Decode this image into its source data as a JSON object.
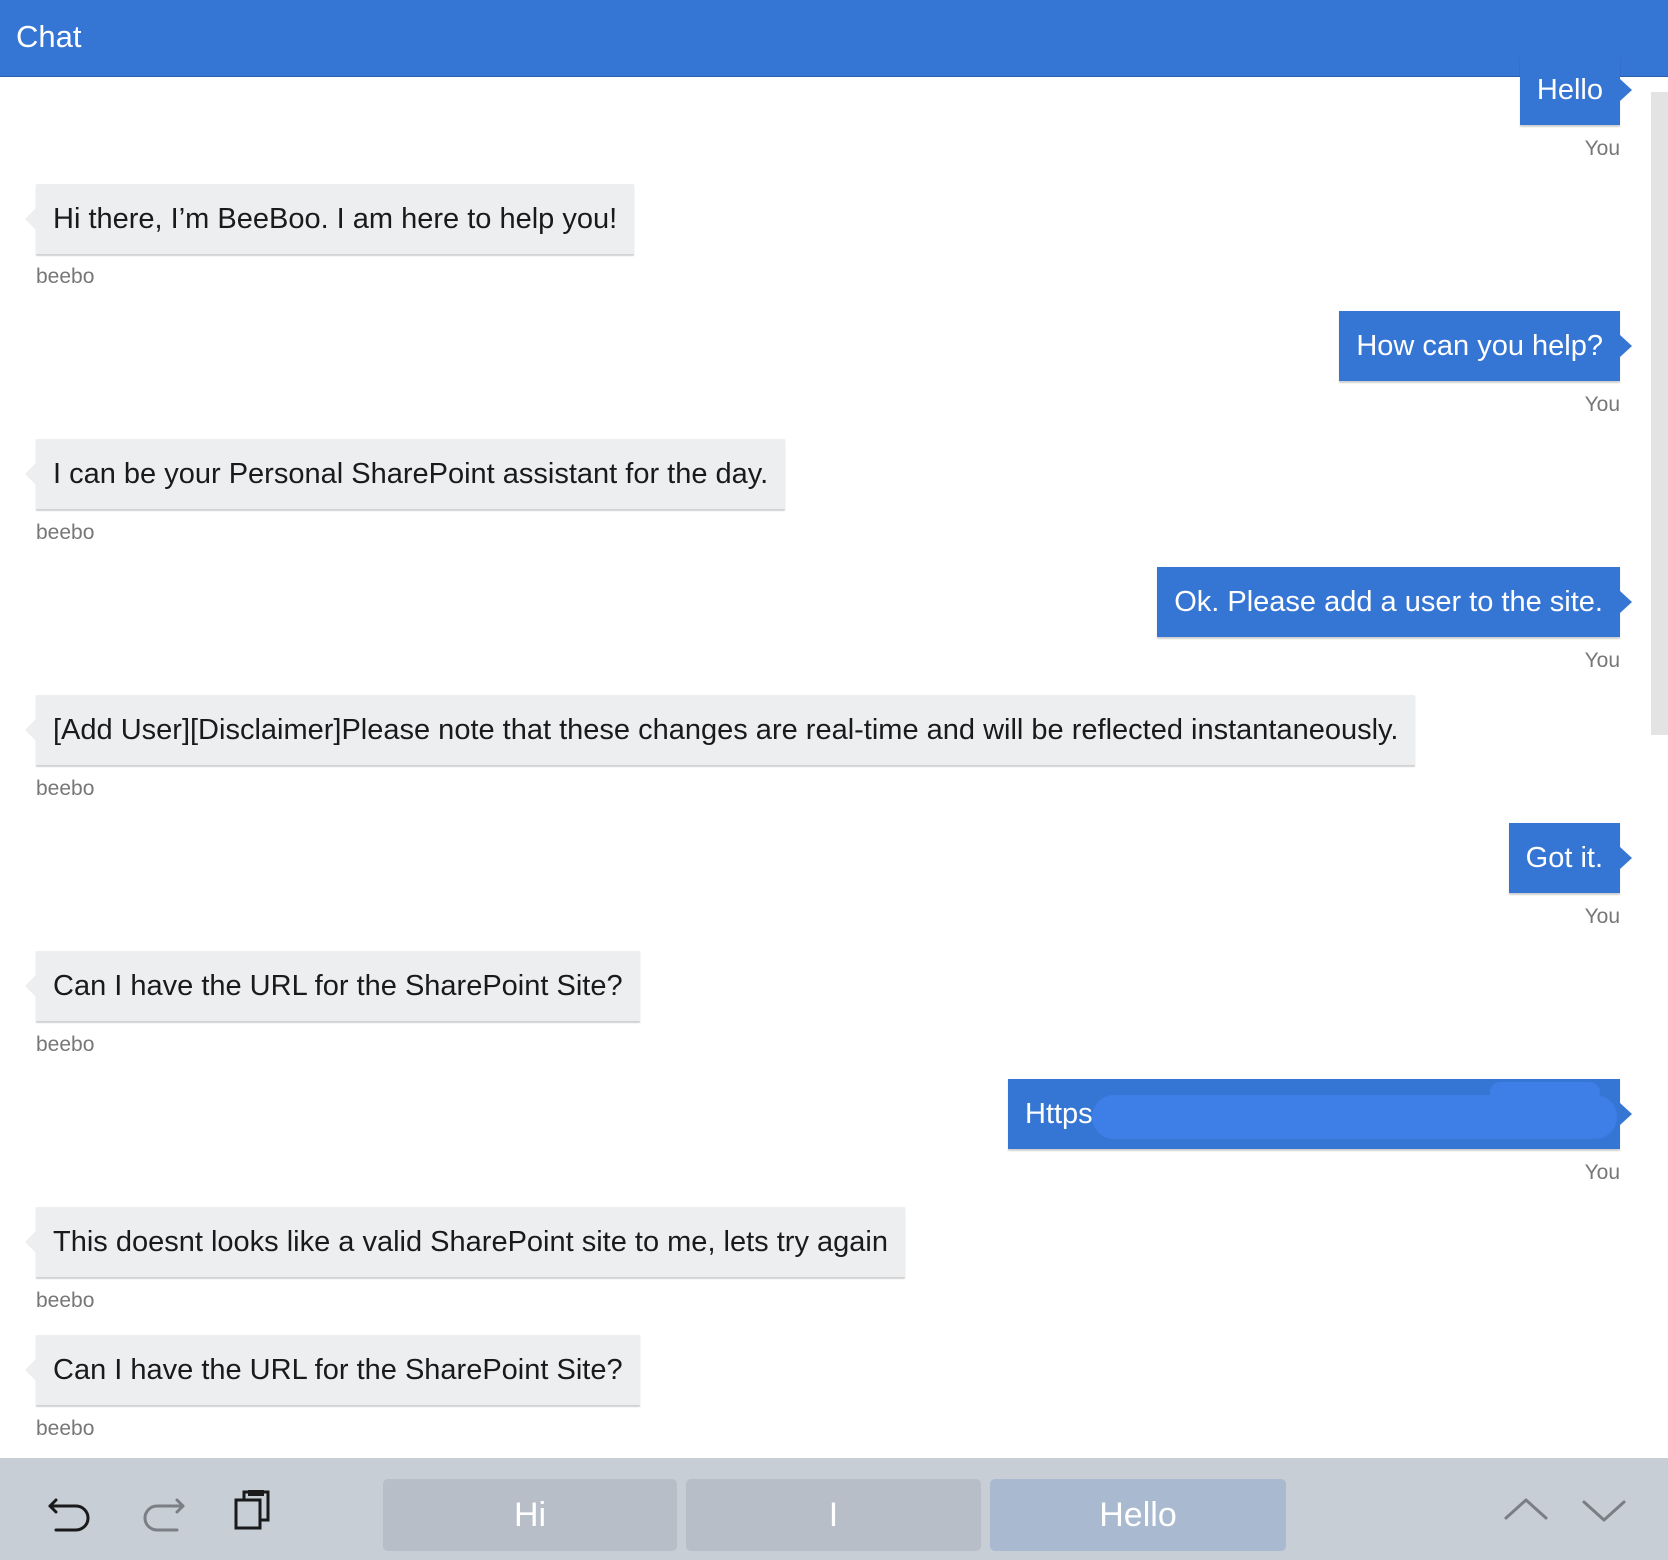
{
  "header": {
    "title": "Chat"
  },
  "messages": [
    {
      "from": "user",
      "text": "Hello",
      "sender": "You"
    },
    {
      "from": "bot",
      "text": "Hi there, I’m BeeBoo. I am here to help you!",
      "sender": "beebo"
    },
    {
      "from": "user",
      "text": "How can you help?",
      "sender": "You"
    },
    {
      "from": "bot",
      "text": "I can be your Personal SharePoint assistant for the day.",
      "sender": "beebo"
    },
    {
      "from": "user",
      "text": "Ok. Please add a user to the site.",
      "sender": "You"
    },
    {
      "from": "bot",
      "text": "[Add User][Disclaimer]Please note that these changes are real-time and will be reflected instantaneously.",
      "sender": "beebo"
    },
    {
      "from": "user",
      "text": "Got it.",
      "sender": "You"
    },
    {
      "from": "bot",
      "text": "Can I have the URL for the SharePoint Site?",
      "sender": "beebo"
    },
    {
      "from": "user",
      "text": "Https",
      "sender": "You",
      "redacted": true
    },
    {
      "from": "bot",
      "text": "This doesnt looks like a valid SharePoint site to me, lets try again",
      "sender": "beebo"
    },
    {
      "from": "bot",
      "text": "Can I have the URL for the SharePoint Site?",
      "sender": "beebo"
    }
  ],
  "keyboard": {
    "undo_icon": "undo-icon",
    "redo_icon": "redo-icon",
    "clipboard_icon": "clipboard-icon",
    "suggestions": [
      "Hi",
      "I",
      "Hello"
    ],
    "up_icon": "chevron-up-icon",
    "down_icon": "chevron-down-icon"
  },
  "colors": {
    "accent": "#3575d3",
    "bot_bubble": "#eceef0",
    "toolbar": "#c8ced6"
  }
}
